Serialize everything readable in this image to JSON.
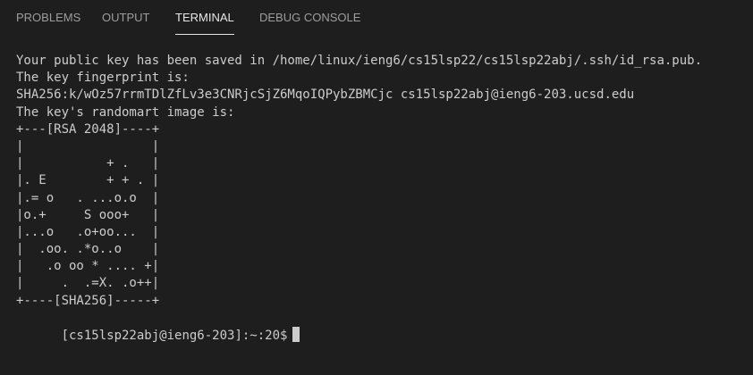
{
  "tabs": {
    "problems": "PROBLEMS",
    "output": "OUTPUT",
    "terminal": "TERMINAL",
    "debug_console": "DEBUG CONSOLE",
    "active": "terminal"
  },
  "terminal": {
    "lines": [
      "Your public key has been saved in /home/linux/ieng6/cs15lsp22/cs15lsp22abj/.ssh/id_rsa.pub.",
      "The key fingerprint is:",
      "SHA256:k/wOz57rrmTDlZfLv3e3CNRjcSjZ6MqoIQPybZBMCjc cs15lsp22abj@ieng6-203.ucsd.edu",
      "The key's randomart image is:",
      "+---[RSA 2048]----+",
      "|                 |",
      "|           + .   |",
      "|. E        + + . |",
      "|.= o   . ...o.o  |",
      "|o.+     S ooo+   |",
      "|...o   .o+oo...  |",
      "|  .oo. .*o..o    |",
      "|   .o oo * .... +|",
      "|     .  .=X. .o++|",
      "+----[SHA256]-----+"
    ],
    "prompt": "[cs15lsp22abj@ieng6-203]:~:20$"
  },
  "colors": {
    "background": "#1e1e1e",
    "text": "#cccccc",
    "tab_inactive": "#9d9d9d",
    "tab_active": "#e7e7e7"
  }
}
